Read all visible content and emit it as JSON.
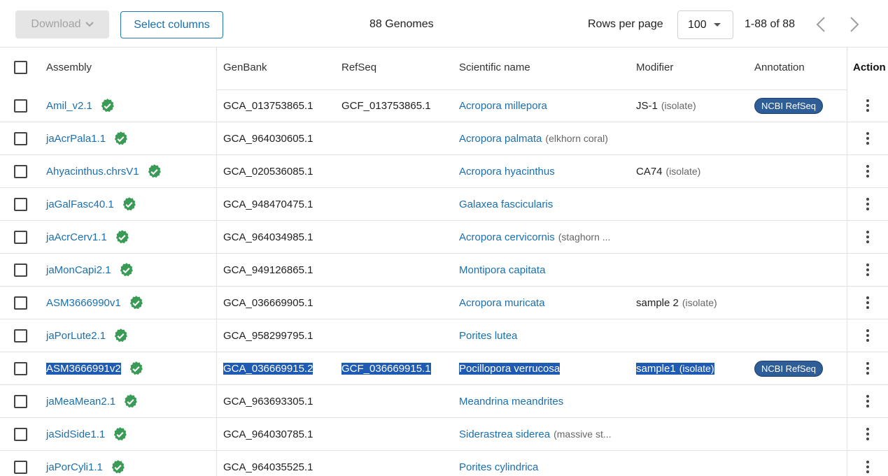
{
  "toolbar": {
    "download_label": "Download",
    "select_columns_label": "Select columns",
    "genome_count": "88 Genomes",
    "rows_per_page_label": "Rows per page",
    "rows_per_page_value": "100",
    "range_text": "1-88 of 88"
  },
  "columns": {
    "assembly": "Assembly",
    "genbank": "GenBank",
    "refseq": "RefSeq",
    "scientific_name": "Scientific name",
    "modifier": "Modifier",
    "annotation": "Annotation",
    "action": "Action"
  },
  "colors": {
    "link": "#1a6fb0",
    "selection": "#1f5bb3",
    "badge": "#2f5d98",
    "verified": "#3a9b56"
  },
  "rows": [
    {
      "assembly": "Amil_v2.1",
      "genbank": "GCA_013753865.1",
      "refseq": "GCF_013753865.1",
      "sci": "Acropora millepora",
      "common": "",
      "mod": "JS-1",
      "mod_type": "(isolate)",
      "annotation": "NCBI RefSeq",
      "selected": false
    },
    {
      "assembly": "jaAcrPala1.1",
      "genbank": "GCA_964030605.1",
      "refseq": "",
      "sci": "Acropora palmata",
      "common": "(elkhorn coral)",
      "mod": "",
      "mod_type": "",
      "annotation": "",
      "selected": false
    },
    {
      "assembly": "Ahyacinthus.chrsV1",
      "genbank": "GCA_020536085.1",
      "refseq": "",
      "sci": "Acropora hyacinthus",
      "common": "",
      "mod": "CA74",
      "mod_type": "(isolate)",
      "annotation": "",
      "selected": false
    },
    {
      "assembly": "jaGalFasc40.1",
      "genbank": "GCA_948470475.1",
      "refseq": "",
      "sci": "Galaxea fascicularis",
      "common": "",
      "mod": "",
      "mod_type": "",
      "annotation": "",
      "selected": false
    },
    {
      "assembly": "jaAcrCerv1.1",
      "genbank": "GCA_964034985.1",
      "refseq": "",
      "sci": "Acropora cervicornis",
      "common": "(staghorn ...",
      "mod": "",
      "mod_type": "",
      "annotation": "",
      "selected": false
    },
    {
      "assembly": "jaMonCapi2.1",
      "genbank": "GCA_949126865.1",
      "refseq": "",
      "sci": "Montipora capitata",
      "common": "",
      "mod": "",
      "mod_type": "",
      "annotation": "",
      "selected": false
    },
    {
      "assembly": "ASM3666990v1",
      "genbank": "GCA_036669905.1",
      "refseq": "",
      "sci": "Acropora muricata",
      "common": "",
      "mod": "sample 2",
      "mod_type": "(isolate)",
      "annotation": "",
      "selected": false
    },
    {
      "assembly": "jaPorLute2.1",
      "genbank": "GCA_958299795.1",
      "refseq": "",
      "sci": "Porites lutea",
      "common": "",
      "mod": "",
      "mod_type": "",
      "annotation": "",
      "selected": false
    },
    {
      "assembly": "ASM3666991v2",
      "genbank": "GCA_036669915.2",
      "refseq": "GCF_036669915.1",
      "sci": "Pocillopora verrucosa",
      "common": "",
      "mod": "sample1",
      "mod_type": "(isolate)",
      "annotation": "NCBI RefSeq",
      "selected": true
    },
    {
      "assembly": "jaMeaMean2.1",
      "genbank": "GCA_963693305.1",
      "refseq": "",
      "sci": "Meandrina meandrites",
      "common": "",
      "mod": "",
      "mod_type": "",
      "annotation": "",
      "selected": false
    },
    {
      "assembly": "jaSidSide1.1",
      "genbank": "GCA_964030785.1",
      "refseq": "",
      "sci": "Siderastrea siderea",
      "common": "(massive st...",
      "mod": "",
      "mod_type": "",
      "annotation": "",
      "selected": false
    },
    {
      "assembly": "jaPorCyli1.1",
      "genbank": "GCA_964035525.1",
      "refseq": "",
      "sci": "Porites cylindrica",
      "common": "",
      "mod": "",
      "mod_type": "",
      "annotation": "",
      "selected": false
    }
  ]
}
